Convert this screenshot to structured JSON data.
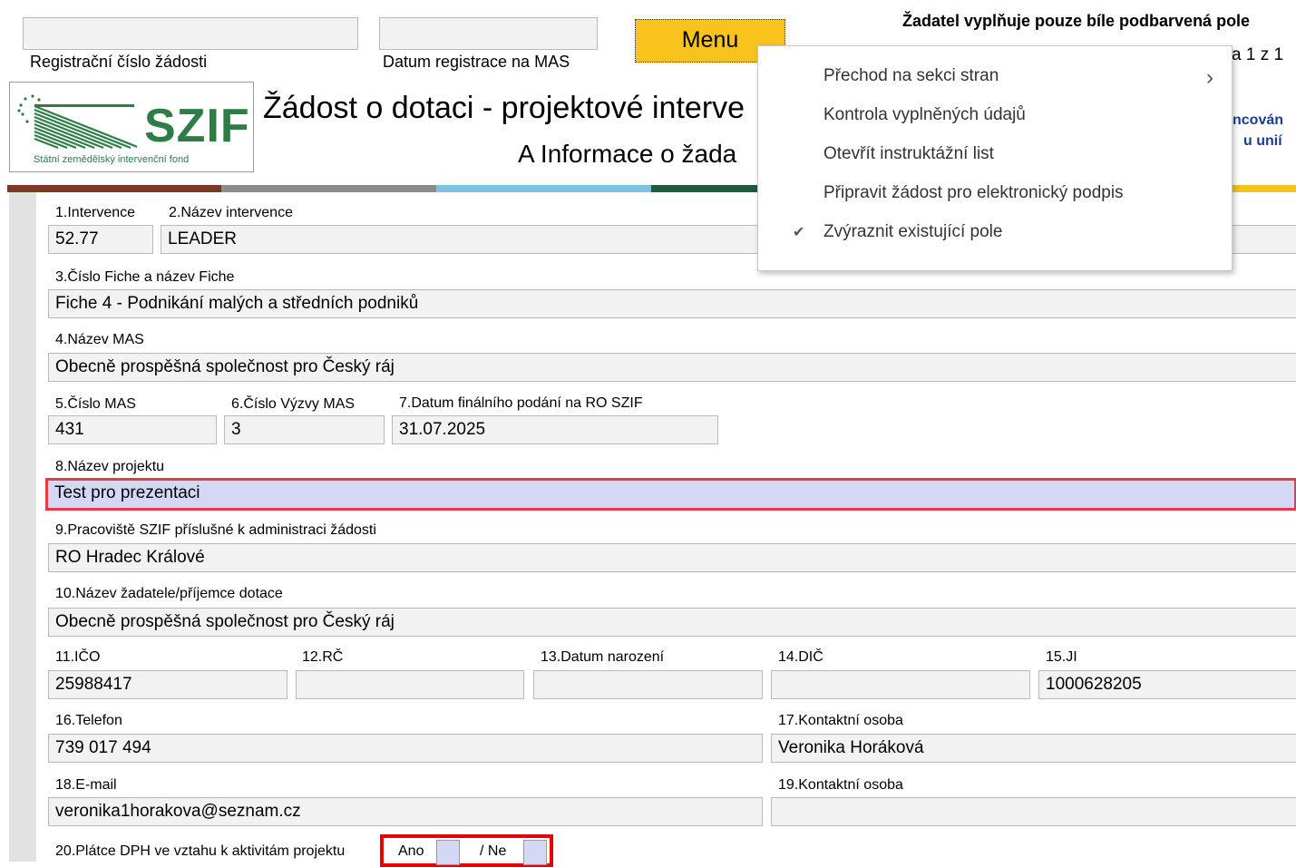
{
  "header": {
    "registration_label": "Registrační číslo žádosti",
    "registration_value": "",
    "date_label": "Datum registrace na MAS",
    "date_value": "",
    "menu_button": "Menu",
    "applicant_note": "Žadatel vyplňuje pouze bíle podbarvená pole",
    "page_indicator_partial": "a 1 z 1",
    "title_partial": "Žádost o dotaci - projektové interve",
    "subtitle_partial": "A Informace o žada",
    "right_partial_1": "ncován",
    "right_partial_2": "u unií"
  },
  "logo": {
    "name": "SZIF",
    "subtitle": "Státní zemědělský intervenční fond"
  },
  "menu": {
    "items": [
      {
        "label": "Přechod na sekci stran",
        "submenu": true,
        "checked": false
      },
      {
        "label": "Kontrola vyplněných údajů",
        "submenu": false,
        "checked": false
      },
      {
        "label": "Otevřít instruktážní list",
        "submenu": false,
        "checked": false
      },
      {
        "label": "Připravit žádost pro elektronický podpis",
        "submenu": false,
        "checked": false
      },
      {
        "label": "Zvýraznit existující pole",
        "submenu": false,
        "checked": true
      }
    ],
    "submenu_glyph": "›",
    "check_glyph": "✔"
  },
  "form": {
    "f1_label": "1.Intervence",
    "f1_value": "52.77",
    "f2_label": "2.Název intervence",
    "f2_value": "LEADER",
    "f3_label": "3.Číslo Fiche a název Fiche",
    "f3_value": "Fiche 4 - Podnikání malých a středních podniků",
    "f4_label": "4.Název MAS",
    "f4_value": "Obecně prospěšná společnost pro Český ráj",
    "f5_label": "5.Číslo MAS",
    "f5_value": "431",
    "f6_label": "6.Číslo Výzvy MAS",
    "f6_value": "3",
    "f7_label": "7.Datum finálního podání na RO SZIF",
    "f7_value": "31.07.2025",
    "f8_label": "8.Název projektu",
    "f8_value": "Test pro prezentaci",
    "f9_label": "9.Pracoviště SZIF příslušné k administraci žádosti",
    "f9_value": "RO Hradec Králové",
    "f10_label": "10.Název žadatele/příjemce dotace",
    "f10_value": "Obecně prospěšná společnost pro Český ráj",
    "f11_label": "11.IČO",
    "f11_value": "25988417",
    "f12_label": "12.RČ",
    "f12_value": "",
    "f13_label": "13.Datum narození",
    "f13_value": "",
    "f14_label": "14.DIČ",
    "f14_value": "",
    "f15_label": "15.JI",
    "f15_value": "1000628205",
    "f16_label": "16.Telefon",
    "f16_value": "739 017 494",
    "f17_label": "17.Kontaktní osoba",
    "f17_value": "Veronika Horáková",
    "f18_label": "18.E-mail",
    "f18_value": "veronika1horakova@seznam.cz",
    "f19_label": "19.Kontaktní osoba",
    "f19_value": "",
    "f20_label": "20.Plátce DPH ve vztahu k aktivitám projektu",
    "f20_yes": "Ano",
    "f20_no": "/ Ne"
  },
  "colors": {
    "menu_button_bg": "#f7c31c",
    "highlight_border": "#e8394a",
    "highlight_field_bg": "#d4d8f4",
    "vat_border": "#e60000",
    "logo_green": "#2e7d46"
  }
}
